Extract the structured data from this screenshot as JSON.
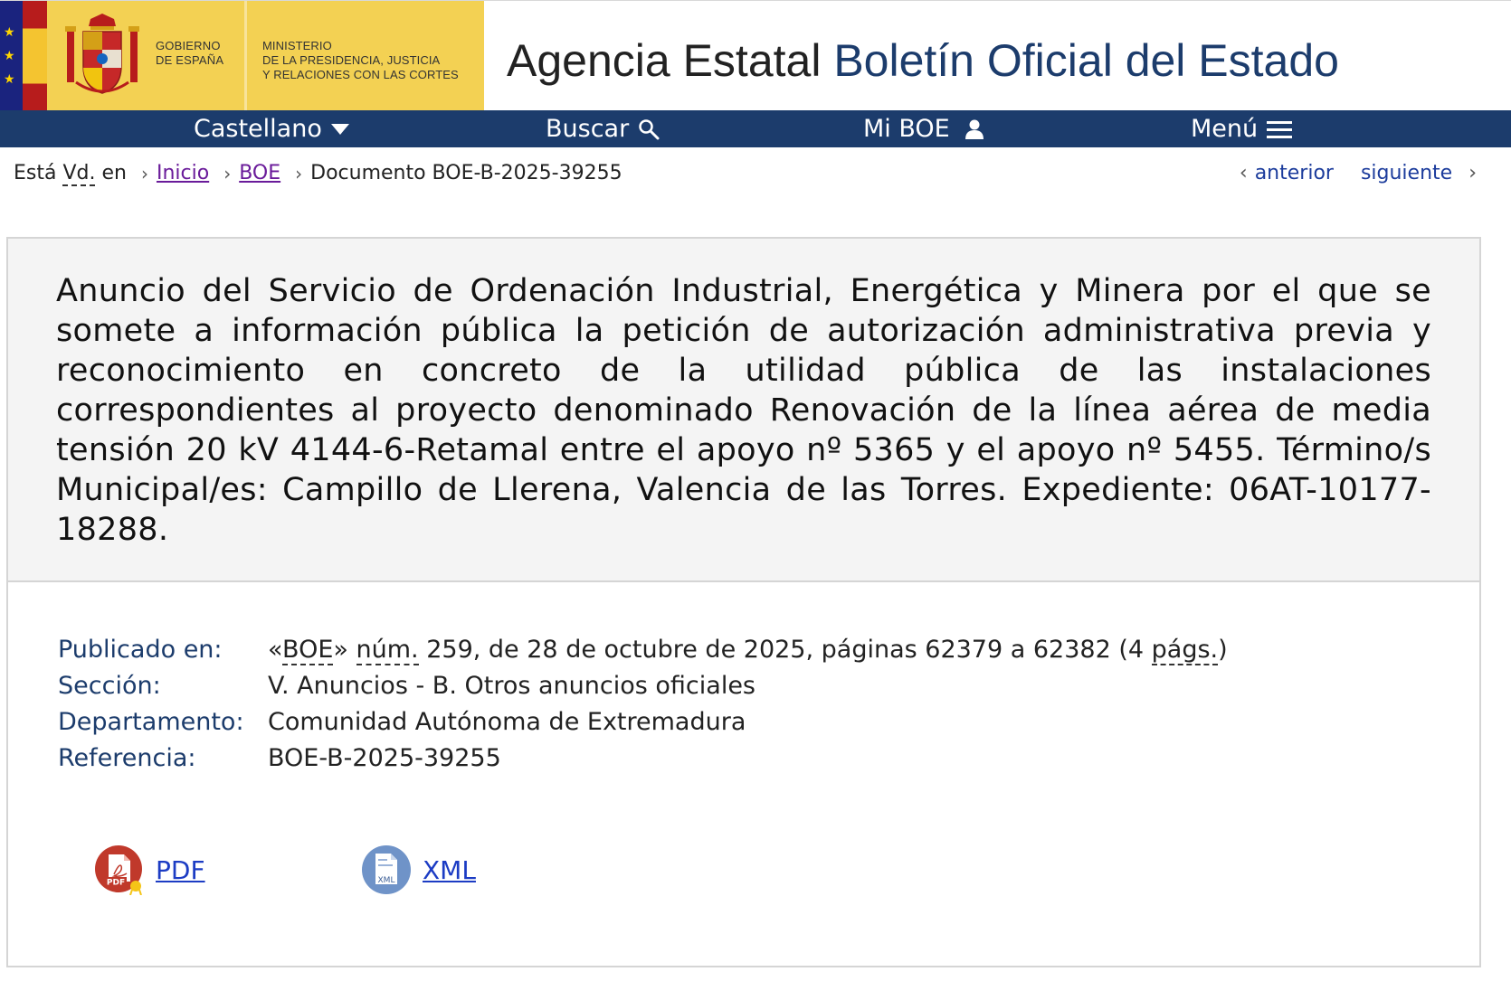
{
  "header": {
    "gov_line1": "GOBIERNO",
    "gov_line2": "DE ESPAÑA",
    "min_line1": "MINISTERIO",
    "min_line2": "DE LA PRESIDENCIA, JUSTICIA",
    "min_line3": "Y RELACIONES CON LAS CORTES",
    "agency_part1": "Agencia Estatal ",
    "agency_part2": "Boletín Oficial del Estado"
  },
  "nav": {
    "language": "Castellano",
    "search": "Buscar",
    "my_boe": "Mi BOE",
    "menu": "Menú"
  },
  "breadcrumb": {
    "prefix1": "Está ",
    "prefix_abbr": "Vd.",
    "prefix2": " en",
    "home": "Inicio",
    "boe": "BOE",
    "current": "Documento BOE-B-2025-39255",
    "previous": "anterior",
    "next": "siguiente"
  },
  "document": {
    "title": "Anuncio del Servicio de Ordenación Industrial, Energética y Minera por el que se somete a información pública la petición de autorización administrativa previa y reconocimiento en concreto de la utilidad pública de las instalaciones correspondientes al proyecto denominado Renovación de la línea aérea de media tensión 20 kV 4144-6-Retamal entre el apoyo nº 5365 y el apoyo nº 5455. Término/s Municipal/es: Campillo de Llerena, Valencia de las Torres. Expediente: 06AT-10177-18288.",
    "published_label": "Publicado en:",
    "published_quote_open": "«",
    "published_boe": "BOE",
    "published_quote_close": "» ",
    "published_num": "núm.",
    "published_rest": " 259, de 28 de octubre de 2025, páginas 62379 a 62382 (4 ",
    "published_pags": "págs.",
    "published_close": ")",
    "section_label": "Sección:",
    "section_value": "V. Anuncios - B. Otros anuncios oficiales",
    "department_label": "Departamento:",
    "department_value": "Comunidad Autónoma de Extremadura",
    "reference_label": "Referencia:",
    "reference_value": "BOE-B-2025-39255"
  },
  "downloads": {
    "pdf_label": "PDF",
    "pdf_icon_text": "PDF",
    "xml_label": "XML",
    "xml_icon_text": "XML"
  },
  "colors": {
    "nav_blue": "#1c3c6c",
    "gov_yellow": "#f3d153",
    "link_blue": "#1c3cc4",
    "visited_purple": "#6a1b9a"
  }
}
